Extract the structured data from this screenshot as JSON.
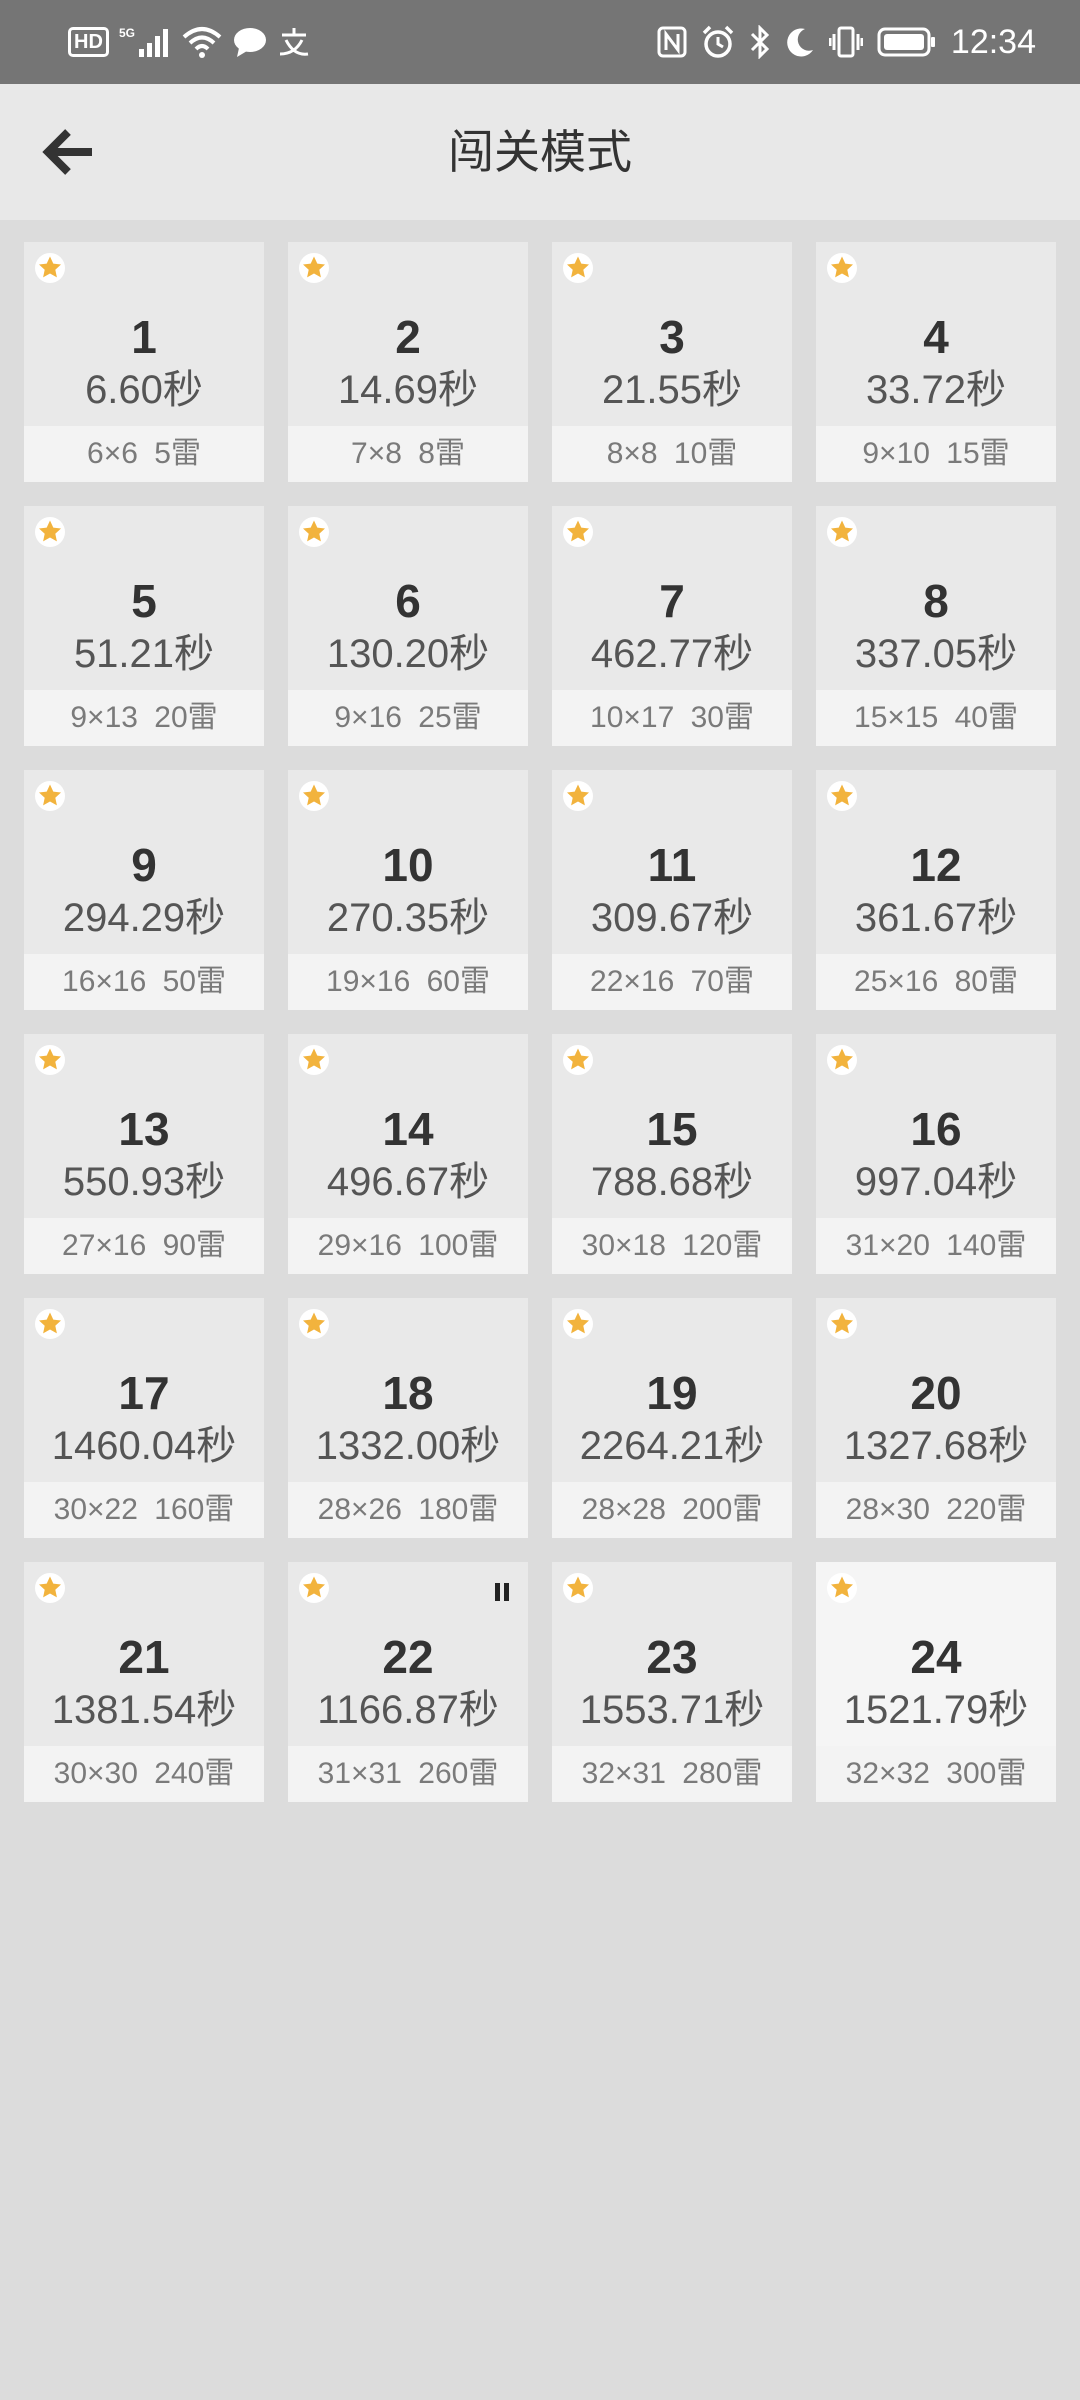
{
  "status_bar": {
    "hd": "HD",
    "network": "5G",
    "time": "12:34",
    "icons_left": [
      "hd-badge",
      "signal-icon",
      "wifi-icon",
      "message-icon",
      "alipay-icon"
    ],
    "icons_right": [
      "nfc-icon",
      "alarm-icon",
      "bluetooth-icon",
      "moon-icon",
      "vibrate-icon",
      "battery-icon"
    ]
  },
  "app_bar": {
    "title": "闯关模式",
    "back_icon": "arrow-left-icon"
  },
  "colors": {
    "star": "#f2b33d",
    "app_bar": "#e8e8e8",
    "status_bar": "#757575",
    "background": "#dcdcdc"
  },
  "levels": [
    {
      "number": "1",
      "time": "6.60秒",
      "info": "6×6 5雷",
      "star": true
    },
    {
      "number": "2",
      "time": "14.69秒",
      "info": "7×8 8雷",
      "star": true
    },
    {
      "number": "3",
      "time": "21.55秒",
      "info": "8×8 10雷",
      "star": true
    },
    {
      "number": "4",
      "time": "33.72秒",
      "info": "9×10 15雷",
      "star": true
    },
    {
      "number": "5",
      "time": "51.21秒",
      "info": "9×13 20雷",
      "star": true
    },
    {
      "number": "6",
      "time": "130.20秒",
      "info": "9×16 25雷",
      "star": true
    },
    {
      "number": "7",
      "time": "462.77秒",
      "info": "10×17 30雷",
      "star": true
    },
    {
      "number": "8",
      "time": "337.05秒",
      "info": "15×15 40雷",
      "star": true
    },
    {
      "number": "9",
      "time": "294.29秒",
      "info": "16×16 50雷",
      "star": true
    },
    {
      "number": "10",
      "time": "270.35秒",
      "info": "19×16 60雷",
      "star": true
    },
    {
      "number": "11",
      "time": "309.67秒",
      "info": "22×16 70雷",
      "star": true
    },
    {
      "number": "12",
      "time": "361.67秒",
      "info": "25×16 80雷",
      "star": true
    },
    {
      "number": "13",
      "time": "550.93秒",
      "info": "27×16 90雷",
      "star": true
    },
    {
      "number": "14",
      "time": "496.67秒",
      "info": "29×16 100雷",
      "star": true
    },
    {
      "number": "15",
      "time": "788.68秒",
      "info": "30×18 120雷",
      "star": true
    },
    {
      "number": "16",
      "time": "997.04秒",
      "info": "31×20 140雷",
      "star": true
    },
    {
      "number": "17",
      "time": "1460.04秒",
      "info": "30×22 160雷",
      "star": true
    },
    {
      "number": "18",
      "time": "1332.00秒",
      "info": "28×26 180雷",
      "star": true
    },
    {
      "number": "19",
      "time": "2264.21秒",
      "info": "28×28 200雷",
      "star": true
    },
    {
      "number": "20",
      "time": "1327.68秒",
      "info": "28×30 220雷",
      "star": true
    },
    {
      "number": "21",
      "time": "1381.54秒",
      "info": "30×30 240雷",
      "star": true
    },
    {
      "number": "22",
      "time": "1166.87秒",
      "info": "31×31 260雷",
      "star": true,
      "paused": true
    },
    {
      "number": "23",
      "time": "1553.71秒",
      "info": "32×31 280雷",
      "star": true
    },
    {
      "number": "24",
      "time": "1521.79秒",
      "info": "32×32 300雷",
      "star": true,
      "current": true
    }
  ]
}
